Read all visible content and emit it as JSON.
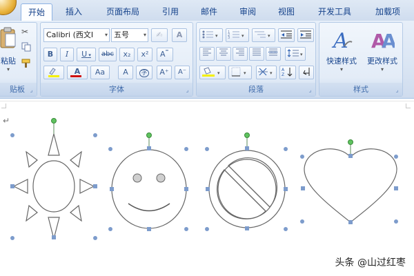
{
  "tabs": [
    {
      "label": "开始",
      "active": true
    },
    {
      "label": "插入"
    },
    {
      "label": "页面布局"
    },
    {
      "label": "引用"
    },
    {
      "label": "邮件"
    },
    {
      "label": "审阅"
    },
    {
      "label": "视图"
    },
    {
      "label": "开发工具"
    },
    {
      "label": "加载项"
    }
  ],
  "clipboard": {
    "paste_label": "粘贴",
    "group_label": "贴板"
  },
  "font": {
    "font_name": "Calibri (西文I",
    "font_size": "五号",
    "clear_format_glyph": "✍",
    "a_glyph": "A",
    "bold": "B",
    "italic": "I",
    "underline": "U",
    "strike": "abc",
    "subscript": "x₂",
    "superscript": "x²",
    "change_case": "Aa",
    "char_border": "A",
    "enclose": "字",
    "grow": "A⁺",
    "shrink": "A⁻",
    "group_label": "字体"
  },
  "paragraph": {
    "group_label": "段落"
  },
  "styles": {
    "quick_styles_label": "快速样式",
    "change_styles_label": "更改样式",
    "group_label": "样式"
  },
  "document": {
    "paragraph_mark": "↵"
  },
  "watermark": {
    "text": "头条 @山过红枣"
  }
}
